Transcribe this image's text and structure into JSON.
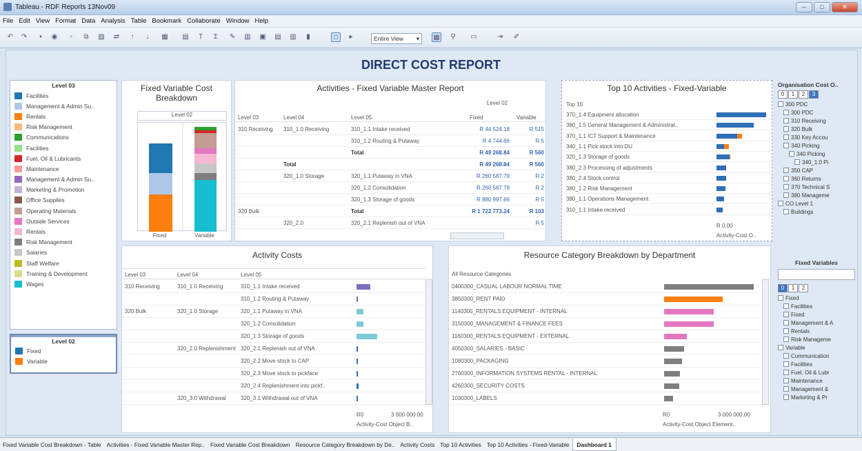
{
  "window": {
    "title": "Tableau - RDF Reports 13Nov09"
  },
  "menu": [
    "File",
    "Edit",
    "View",
    "Format",
    "Data",
    "Analysis",
    "Table",
    "Bookmark",
    "Collaborate",
    "Window",
    "Help"
  ],
  "toolbar": {
    "view_select": "Entire View"
  },
  "dashboard": {
    "title": "DIRECT COST REPORT"
  },
  "legend1": {
    "header": "Level 03",
    "items": [
      {
        "label": "Facilities",
        "color": "#1f77b4"
      },
      {
        "label": "Management & Admin Su..",
        "color": "#aec7e8"
      },
      {
        "label": "Rentals",
        "color": "#ff7f0e"
      },
      {
        "label": "Risk Management",
        "color": "#ffbb78"
      },
      {
        "label": "Communications",
        "color": "#2ca02c"
      },
      {
        "label": "Facilities",
        "color": "#98df8a"
      },
      {
        "label": "Fuel, Oil & Lubricants",
        "color": "#d62728"
      },
      {
        "label": "Maintenance",
        "color": "#ff9896"
      },
      {
        "label": "Management & Admin Su..",
        "color": "#9467bd"
      },
      {
        "label": "Marketing & Promotion",
        "color": "#c5b0d5"
      },
      {
        "label": "Office Supplies",
        "color": "#8c564b"
      },
      {
        "label": "Operating Materials",
        "color": "#c49c94"
      },
      {
        "label": "Outside Services",
        "color": "#e377c2"
      },
      {
        "label": "Rentals",
        "color": "#f7b6d2"
      },
      {
        "label": "Risk Management",
        "color": "#7f7f7f"
      },
      {
        "label": "Salaries",
        "color": "#c7c7c7"
      },
      {
        "label": "Staff Welfare",
        "color": "#bcbd22"
      },
      {
        "label": "Training & Development",
        "color": "#dbdb8d"
      },
      {
        "label": "Wages",
        "color": "#17becf"
      }
    ]
  },
  "legend2": {
    "header": "Level 02",
    "items": [
      {
        "label": "Fixed",
        "color": "#1f77b4"
      },
      {
        "label": "Variable",
        "color": "#ff7f0e"
      }
    ]
  },
  "fixed_variable": {
    "title": "Fixed Variable Cost Breakdown",
    "header": "Level 02",
    "col1": "Fixed",
    "col2": "Variable"
  },
  "master": {
    "title": "Activities - Fixed Variable Master Report",
    "level02": "Level 02",
    "headers": [
      "Level 03",
      "Level 04",
      "Level 05",
      "Fixed",
      "Variable"
    ],
    "rows": [
      {
        "l3": "310 Receiving",
        "l4": "310_1.0 Receiving",
        "l5": "310_1.1 Intake received",
        "fixed": "R 44 524.18",
        "var": "R 515"
      },
      {
        "l5": "310_1.2 Routing & Putaway",
        "fixed": "R 4 744.66",
        "var": "R 5"
      },
      {
        "l5": "Total",
        "fixed": "R 49 268.84",
        "var": "R 560"
      },
      {
        "l4": "Total",
        "fixed": "R 49 268.84",
        "var": "R 560"
      },
      {
        "l4": "320_1.0 Storage",
        "l5": "320_1.1 Putaway in VNA",
        "fixed": "R 260 587.79",
        "var": "R 2"
      },
      {
        "l5": "320_1.2 Consolidation",
        "fixed": "R 260 587.79",
        "var": "R 2"
      },
      {
        "l5": "320_1.3 Storage of goods",
        "fixed": "R 880 997.66",
        "var": "R 5"
      },
      {
        "l3": "320 Bulk",
        "l5": "Total",
        "fixed": "R 1 722 773.24",
        "var": "R 103"
      },
      {
        "l4": "320_2.0",
        "l5": "320_2.1 Replenish out of VNA",
        "fixed": "",
        "var": "R 5"
      }
    ]
  },
  "top10": {
    "title": "Top 10 Activities - Fixed-Variable",
    "header": "Top 10",
    "items": [
      {
        "label": "370_1.4 Equipment allocation",
        "fixed": 1,
        "var": 0
      },
      {
        "label": "380_1.5 General Management & Administrat..",
        "fixed": 0.75,
        "var": 0
      },
      {
        "label": "370_1.1 ICT Support & Maintenance",
        "fixed": 0.42,
        "var": 0.1
      },
      {
        "label": "340_1.1 Pick stock into DU",
        "fixed": 0.15,
        "var": 0.1
      },
      {
        "label": "320_1.3 Storage of goods",
        "fixed": 0.27,
        "var": 0.02
      },
      {
        "label": "380_2.3 Processing of adjustments",
        "fixed": 0.2,
        "var": 0
      },
      {
        "label": "380_2.4 Stock control",
        "fixed": 0.2,
        "var": 0
      },
      {
        "label": "380_1.2 Risk Management",
        "fixed": 0.18,
        "var": 0
      },
      {
        "label": "380_1.1 Operations Management",
        "fixed": 0.15,
        "var": 0
      },
      {
        "label": "310_1.1 Intake received",
        "fixed": 0.12,
        "var": 0
      }
    ],
    "axis_label": "R 0.00",
    "axis_title": "Activity-Cost O.."
  },
  "org": {
    "title": "Organisation Cost O..",
    "levels": [
      "0",
      "1",
      "2",
      "3"
    ],
    "items": [
      "300 PDC",
      "300 PDC",
      "310 Receiving",
      "320 Bulk",
      "330 Key Accou",
      "340 Picking",
      "340 Picking",
      "340_1.0 Pi",
      "350 CAP",
      "360 Returns",
      "370 Technical S",
      "380 Manageme",
      "CO Level 1",
      "Buildings"
    ]
  },
  "activity_costs": {
    "title": "Activity Costs",
    "headers": [
      "Level 03",
      "Level 04",
      "Level 05"
    ],
    "rows": [
      {
        "l3": "310 Receiving",
        "l4": "310_1.0 Receiving",
        "l5": "310_1.1 Intake received",
        "v": 0.2
      },
      {
        "l5": "310_1.2 Routing & Putaway",
        "v": 0.02
      },
      {
        "l3": "320 Bulk",
        "l4": "320_1.0 Storage",
        "l5": "320_1.1 Putaway in VNA",
        "v": 0.1
      },
      {
        "l5": "320_1.2 Consolidation",
        "v": 0.1
      },
      {
        "l5": "320_1.3 Storage of goods",
        "v": 0.3
      },
      {
        "l4": "320_2.0 Replenishment",
        "l5": "320_2.1 Replenish out of VNA",
        "v": 0.02
      },
      {
        "l5": "320_2.2 Move stock to CAP",
        "v": 0.02
      },
      {
        "l5": "320_2.3 Move stock to pickface",
        "v": 0.02
      },
      {
        "l5": "320_2.4 Replenishment into pickf..",
        "v": 0.03
      },
      {
        "l4": "320_3.0 Withdrawal",
        "l5": "320_3.1 Withdrawal out of VNA",
        "v": 0.01
      }
    ],
    "axis": [
      "R0",
      "3 000 000.00"
    ],
    "axis_title": "Activity-Cost Object B.."
  },
  "resource": {
    "title": "Resource Category Breakdown by Department",
    "header": "All Resource Categories",
    "rows": [
      {
        "label": "0400300_CASUAL LABOUR NORMAL TIME",
        "v": 1
      },
      {
        "label": "3850300_RENT PAID",
        "v": 0.65
      },
      {
        "label": "1140300_RENTALS EQUIPMENT - INTERNAL",
        "v": 0.55
      },
      {
        "label": "3150300_MANAGEMENT & FINANCE FEES",
        "v": 0.55
      },
      {
        "label": "1160300_RENTALS EQUIPMENT - EXTERNAL",
        "v": 0.25
      },
      {
        "label": "4050300_SALARIES - BASIC",
        "v": 0.22
      },
      {
        "label": "1080300_PACKAGING",
        "v": 0.2
      },
      {
        "label": "2760300_INFORMATION SYSTEMS RENTAL - INTERNAL",
        "v": 0.18
      },
      {
        "label": "4260300_SECURITY COSTS",
        "v": 0.17
      },
      {
        "label": "1030300_LABELS",
        "v": 0.1
      }
    ],
    "axis": [
      "R0",
      "3 000 000.00"
    ],
    "axis_title": "Activity-Cost Object Element.."
  },
  "fixedvars": {
    "title": "Fixed Variables",
    "levels": [
      "0",
      "1",
      "2"
    ],
    "items": [
      "Fixed",
      "Facilities",
      "Fixed",
      "Management & A",
      "Rentals",
      "Risk Manageme",
      "Variable",
      "Communication",
      "Facilities",
      "Fuel, Oil & Lubr",
      "Maintenance",
      "Management &",
      "Marketing & Pr"
    ]
  },
  "tabs": [
    "Fixed Variable Cost Breakdown - Table",
    "Activities - Fixed Variable Master Rep..",
    "Fixed Variable Cost Breakdown",
    "Resource Category Breakdown by De..",
    "Activity Costs",
    "Top 10 Activities",
    "Top 10 Activities - Fixed-Variable",
    "Dashboard 1"
  ]
}
